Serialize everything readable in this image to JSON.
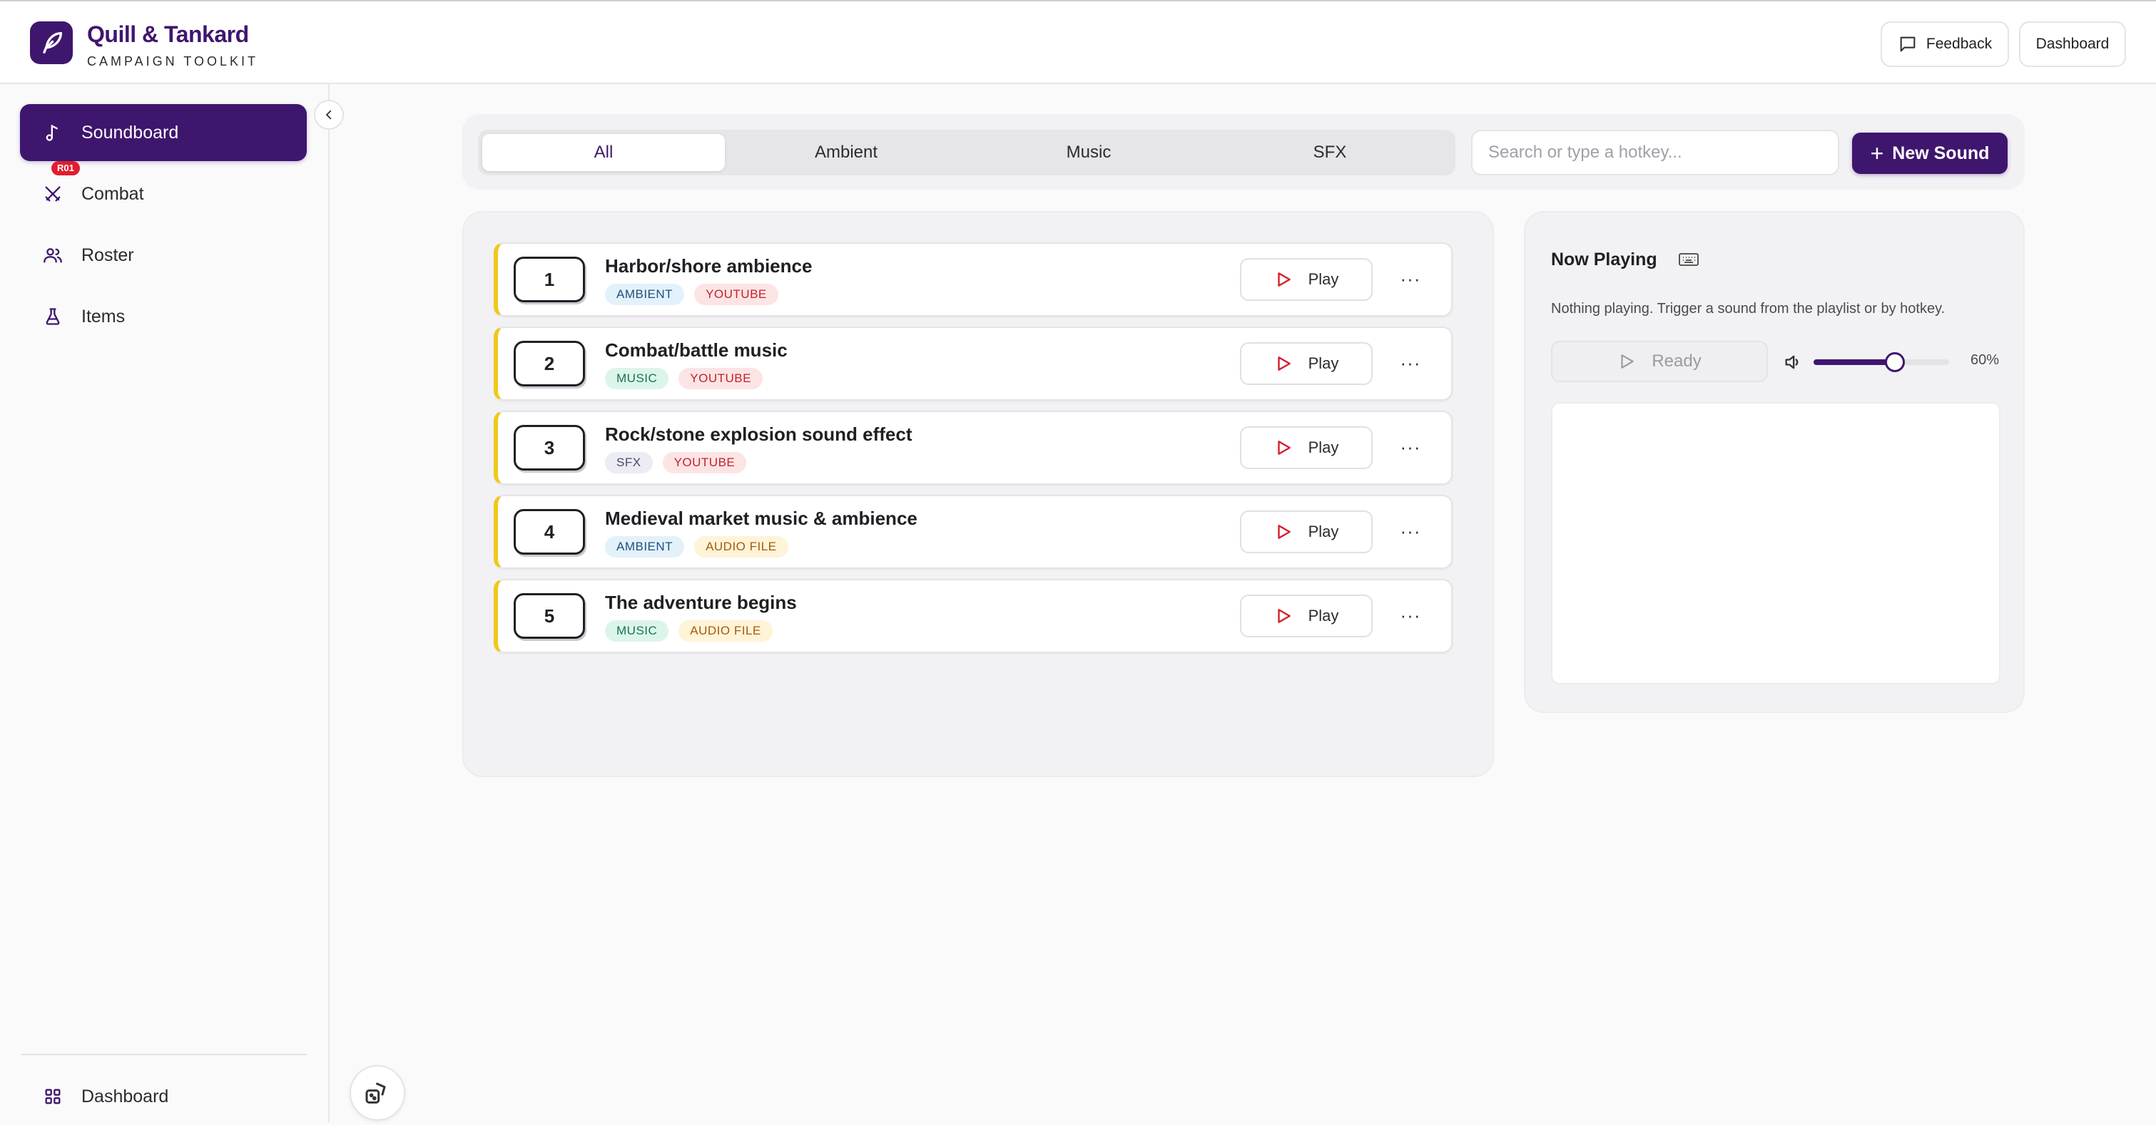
{
  "brand": {
    "title": "Quill & Tankard",
    "subtitle": "CAMPAIGN TOOLKIT"
  },
  "header": {
    "feedback_label": "Feedback",
    "dashboard_label": "Dashboard"
  },
  "sidebar": {
    "items": [
      {
        "label": "Soundboard",
        "icon": "music-note-icon",
        "active": true
      },
      {
        "label": "Combat",
        "icon": "crossed-swords-icon",
        "badge": "R01"
      },
      {
        "label": "Roster",
        "icon": "users-icon"
      },
      {
        "label": "Items",
        "icon": "flask-icon"
      }
    ],
    "bottom_item": {
      "label": "Dashboard",
      "icon": "grid-icon"
    }
  },
  "filters": {
    "tabs": [
      "All",
      "Ambient",
      "Music",
      "SFX"
    ],
    "active_tab": "All",
    "search_placeholder": "Search or type a hotkey...",
    "new_sound_label": "New Sound"
  },
  "playlist": {
    "play_label": "Play",
    "rows": [
      {
        "hotkey": "1",
        "title": "Harbor/shore ambience",
        "tags": [
          {
            "text": "AMBIENT",
            "kind": "ambient"
          },
          {
            "text": "YOUTUBE",
            "kind": "youtube"
          }
        ]
      },
      {
        "hotkey": "2",
        "title": "Combat/battle music",
        "tags": [
          {
            "text": "MUSIC",
            "kind": "music"
          },
          {
            "text": "YOUTUBE",
            "kind": "youtube"
          }
        ]
      },
      {
        "hotkey": "3",
        "title": "Rock/stone explosion sound effect",
        "tags": [
          {
            "text": "SFX",
            "kind": "sfx"
          },
          {
            "text": "YOUTUBE",
            "kind": "youtube"
          }
        ]
      },
      {
        "hotkey": "4",
        "title": "Medieval market music & ambience",
        "tags": [
          {
            "text": "AMBIENT",
            "kind": "ambient"
          },
          {
            "text": "AUDIO FILE",
            "kind": "audio"
          }
        ]
      },
      {
        "hotkey": "5",
        "title": "The adventure begins",
        "tags": [
          {
            "text": "MUSIC",
            "kind": "music"
          },
          {
            "text": "AUDIO FILE",
            "kind": "audio"
          }
        ]
      }
    ]
  },
  "now_playing": {
    "title": "Now Playing",
    "description": "Nothing playing. Trigger a sound from the playlist or by hotkey.",
    "ready_label": "Ready",
    "volume_percent": 60,
    "volume_label": "60%"
  },
  "colors": {
    "accent": "#3f166e",
    "row_accent": "#f2c81a",
    "play_icon": "#d4202c",
    "badge": "#e11d2e"
  }
}
